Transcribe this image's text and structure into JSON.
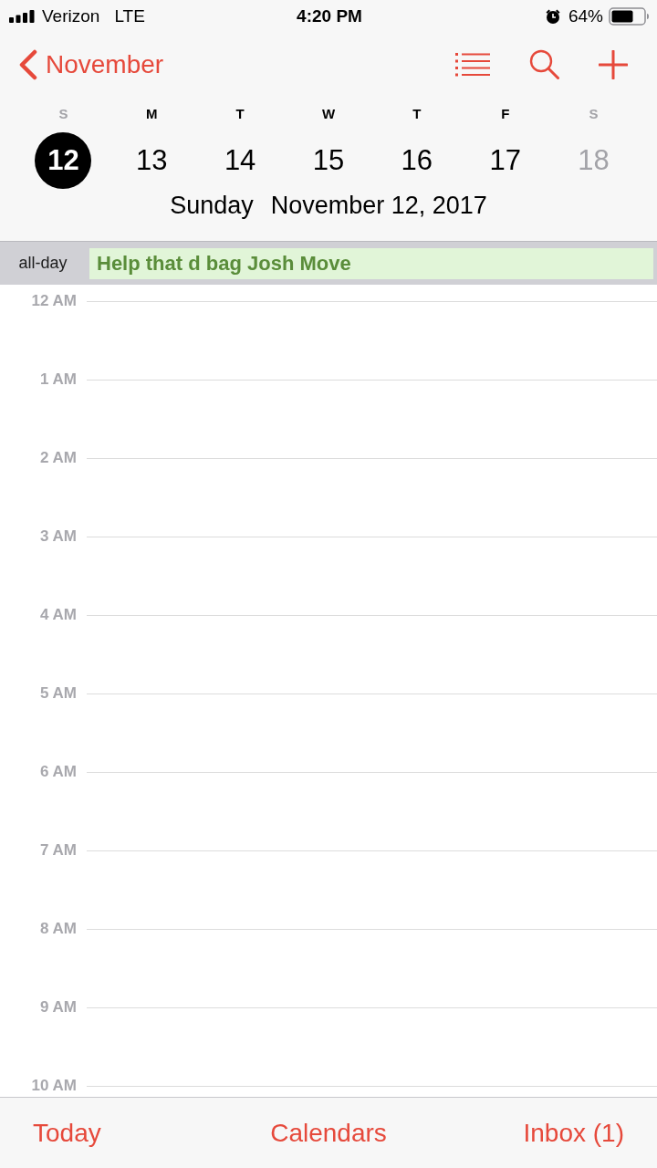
{
  "status_bar": {
    "carrier": "Verizon",
    "network": "LTE",
    "time": "4:20 PM",
    "battery": "64%"
  },
  "nav_bar": {
    "back_label": "November"
  },
  "week": [
    {
      "letter": "S",
      "date": "12",
      "weekend": true,
      "selected": true
    },
    {
      "letter": "M",
      "date": "13",
      "weekend": false,
      "selected": false
    },
    {
      "letter": "T",
      "date": "14",
      "weekend": false,
      "selected": false
    },
    {
      "letter": "W",
      "date": "15",
      "weekend": false,
      "selected": false
    },
    {
      "letter": "T",
      "date": "16",
      "weekend": false,
      "selected": false
    },
    {
      "letter": "F",
      "date": "17",
      "weekend": false,
      "selected": false
    },
    {
      "letter": "S",
      "date": "18",
      "weekend": true,
      "selected": false
    }
  ],
  "selected_day": {
    "weekday": "Sunday",
    "date": "November 12, 2017"
  },
  "all_day": {
    "label": "all-day",
    "events": [
      {
        "title": "Help that d bag Josh Move",
        "color": "#5a8d3a"
      }
    ]
  },
  "hours": [
    "12 AM",
    "1 AM",
    "2 AM",
    "3 AM",
    "4 AM",
    "5 AM",
    "6 AM",
    "7 AM",
    "8 AM",
    "9 AM",
    "10 AM"
  ],
  "tab_bar": [
    "Today",
    "Calendars",
    "Inbox (1)"
  ]
}
